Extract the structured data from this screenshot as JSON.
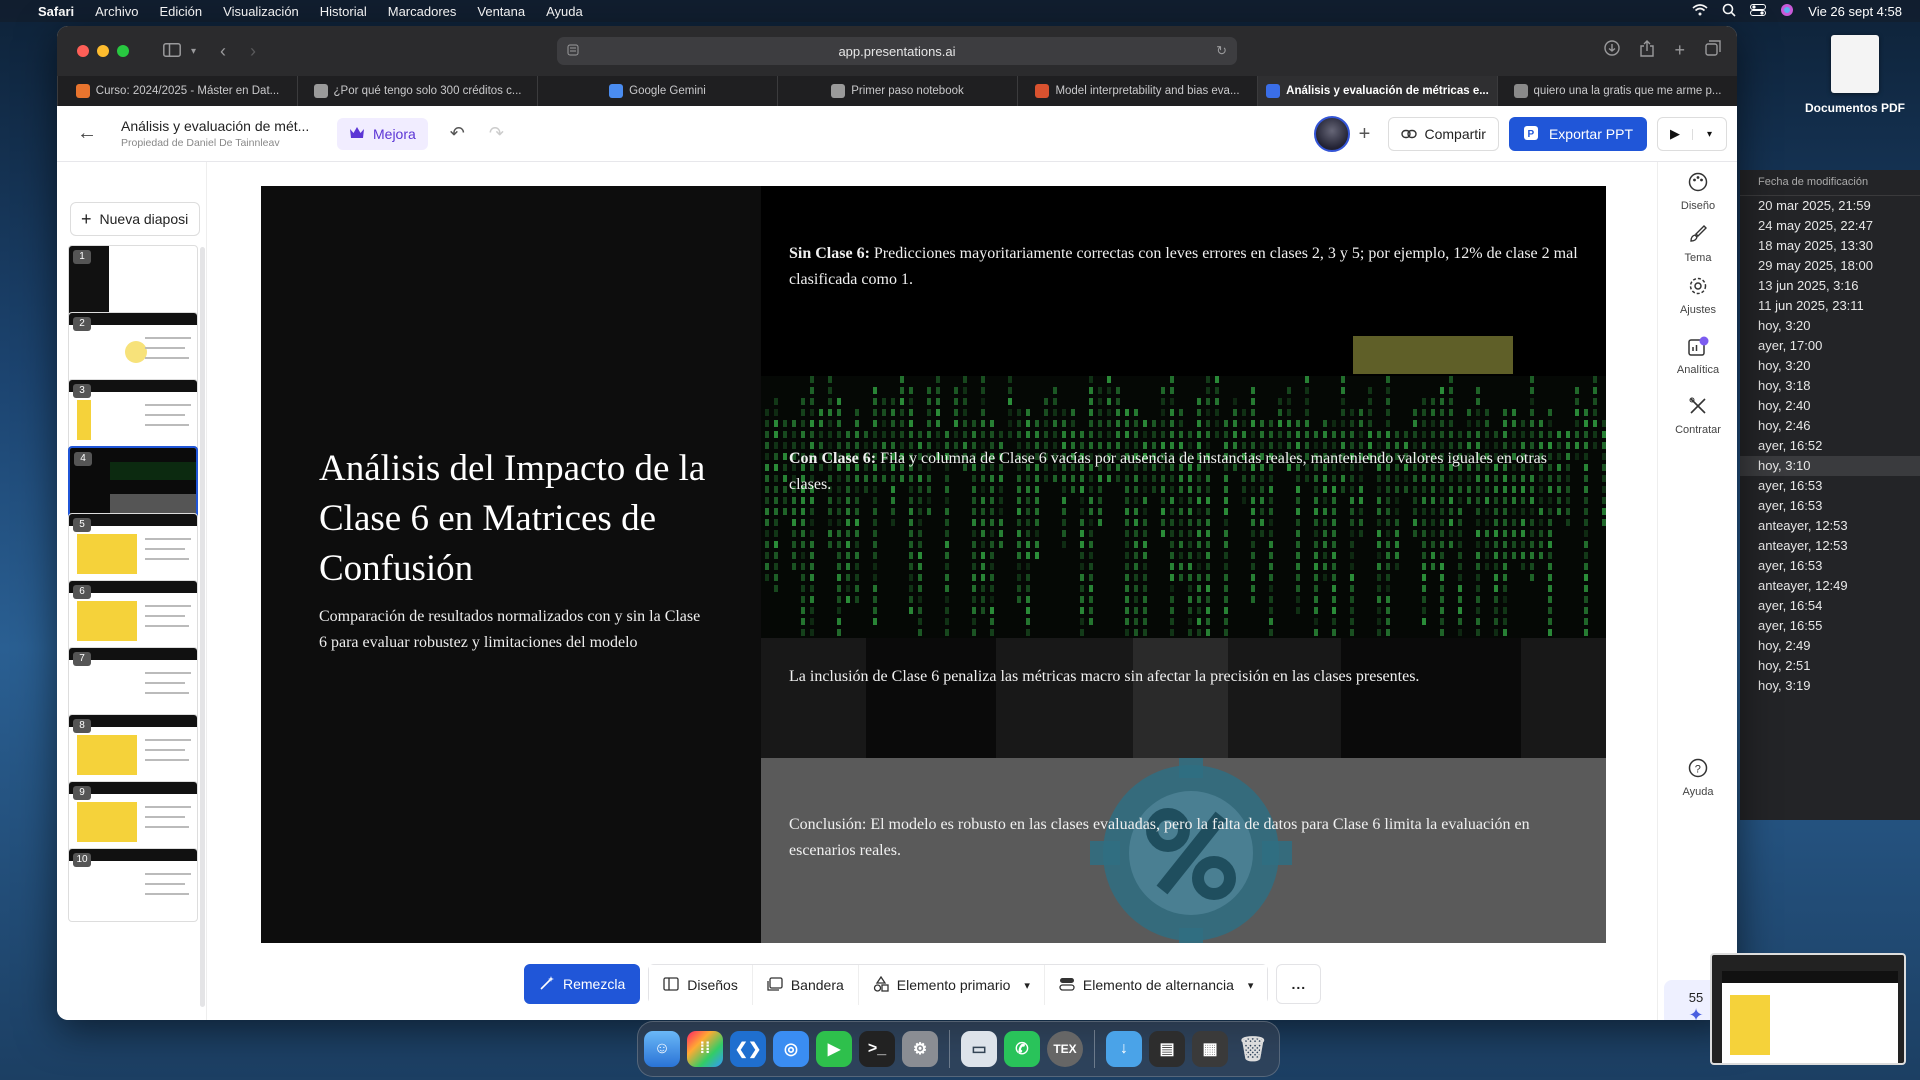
{
  "menubar": {
    "app": "Safari",
    "items": [
      "Archivo",
      "Edición",
      "Visualización",
      "Historial",
      "Marcadores",
      "Ventana",
      "Ayuda"
    ],
    "datetime": "Vie 26 sept 4:58"
  },
  "desktop": {
    "icon_label": "Documentos PDF"
  },
  "finder": {
    "column_header": "Fecha de modificación",
    "dates": [
      "20 mar 2025, 21:59",
      "24 may 2025, 22:47",
      "18 may 2025, 13:30",
      "29 may 2025, 18:00",
      "13 jun 2025, 3:16",
      "11 jun 2025, 23:11",
      "hoy, 3:20",
      "ayer, 17:00",
      "hoy, 3:20",
      "hoy, 3:18",
      "hoy, 2:40",
      "hoy, 2:46",
      "ayer, 16:52",
      "hoy, 3:10",
      "ayer, 16:53",
      "ayer, 16:53",
      "anteayer, 12:53",
      "anteayer, 12:53",
      "ayer, 16:53",
      "anteayer, 12:49",
      "ayer, 16:54",
      "ayer, 16:55",
      "hoy, 2:49",
      "hoy, 2:51",
      "hoy, 3:19"
    ],
    "selected_index": 13
  },
  "browser": {
    "url": "app.presentations.ai",
    "tabs": [
      {
        "label": "Curso: 2024/2025 - Máster en Dat...",
        "color": "#e8742e"
      },
      {
        "label": "¿Por qué tengo solo 300 créditos c...",
        "color": "#9a9a9a"
      },
      {
        "label": "Google Gemini",
        "color": "#4a8cf0"
      },
      {
        "label": "Primer paso notebook",
        "color": "#9a9a9a"
      },
      {
        "label": "Model interpretability and bias eva...",
        "color": "#d9522f"
      },
      {
        "label": "Análisis y evaluación de métricas e...",
        "color": "#3a6ee8"
      },
      {
        "label": "quiero una la gratis que me arme p...",
        "color": "#8a8a8a"
      }
    ],
    "active_tab": 5
  },
  "app": {
    "doc_title": "Análisis y evaluación de mét...",
    "doc_owner": "Propiedad de Daniel De Tainnleav",
    "mejora": "Mejora",
    "share": "Compartir",
    "export": "Exportar PPT",
    "new_slide": "Nueva diaposi",
    "slide_numbers": [
      "1",
      "2",
      "3",
      "4",
      "5",
      "6",
      "7",
      "8",
      "9",
      "10"
    ],
    "selected_slide": 4
  },
  "slide": {
    "title": "Análisis del Impacto de la Clase 6 en Matrices de Confusión",
    "subtitle": "Comparación de resultados normalizados con y sin la Clase 6 para evaluar robustez y limitaciones del modelo",
    "point1_label": "Sin Clase 6:",
    "point1_text": " Predicciones mayoritariamente correctas con leves errores en clases 2, 3 y 5; por ejemplo, 12% de clase 2 mal clasificada como 1.",
    "point2_label": "Con Clase 6:",
    "point2_text": " Fila y columna de Clase 6 vacías por ausencia de instancias reales, manteniendo valores iguales en otras clases.",
    "point3_text": "La inclusión de Clase 6 penaliza las métricas macro sin afectar la precisión en las clases presentes.",
    "point4_text": "Conclusión: El modelo es robusto en las clases evaluadas, pero la falta de datos para Clase 6 limita la evaluación en escenarios reales."
  },
  "rightrail": {
    "items": [
      "Diseño",
      "Tema",
      "Ajustes",
      "Analítica",
      "Contratar"
    ],
    "help": "Ayuda",
    "credits": "55"
  },
  "bottombar": {
    "remix": "Remezcla",
    "designs": "Diseños",
    "flag": "Bandera",
    "primary": "Elemento primario",
    "alternate": "Elemento de alternancia",
    "more": "..."
  },
  "colors": {
    "accent": "#2056d8",
    "mejora": "#5b35d5",
    "highlight_yellow": "#f5d23a"
  }
}
